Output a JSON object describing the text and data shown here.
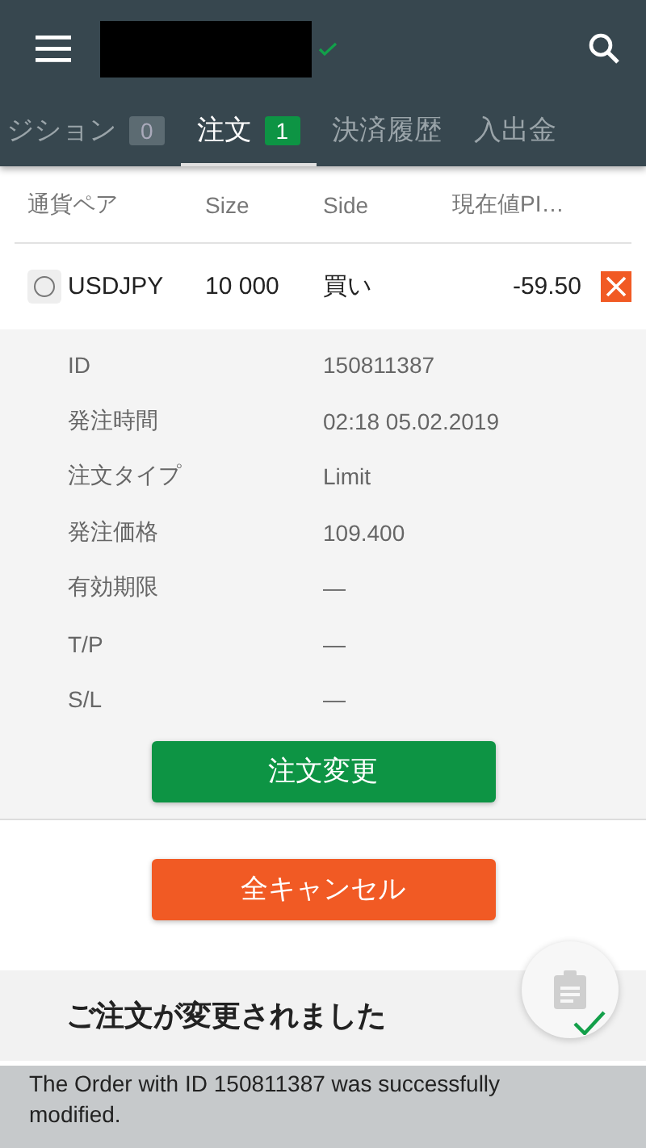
{
  "header": {
    "verified": true
  },
  "tabs": [
    {
      "label": "ジション",
      "count": "0",
      "selected": false
    },
    {
      "label": "注文",
      "count": "1",
      "selected": true
    },
    {
      "label": "決済履歴",
      "selected": false
    },
    {
      "label": "入出金",
      "selected": false
    }
  ],
  "table": {
    "columns": [
      "通貨ペア",
      "Size",
      "Side",
      "現在値PI…"
    ],
    "rows": [
      {
        "selected": false,
        "pair": "USDJPY",
        "size": "10 000",
        "side": "買い",
        "value": "-59.50"
      }
    ]
  },
  "details": [
    {
      "label": "ID",
      "value": "150811387"
    },
    {
      "label": "発注時間",
      "value": "02:18 05.02.2019"
    },
    {
      "label": "注文タイプ",
      "value": "Limit"
    },
    {
      "label": "発注価格",
      "value": "109.400"
    },
    {
      "label": "有効期限",
      "value": "—"
    },
    {
      "label": "T/P",
      "value": "—"
    },
    {
      "label": "S/L",
      "value": "—"
    }
  ],
  "modify_button": "注文変更",
  "cancel_all_button": "全キャンセル",
  "footer": {
    "kind": "overlaid"
  },
  "toast": {
    "title": "ご注文が変更されました",
    "message": "The Order with ID 150811387 was successfully modified."
  }
}
